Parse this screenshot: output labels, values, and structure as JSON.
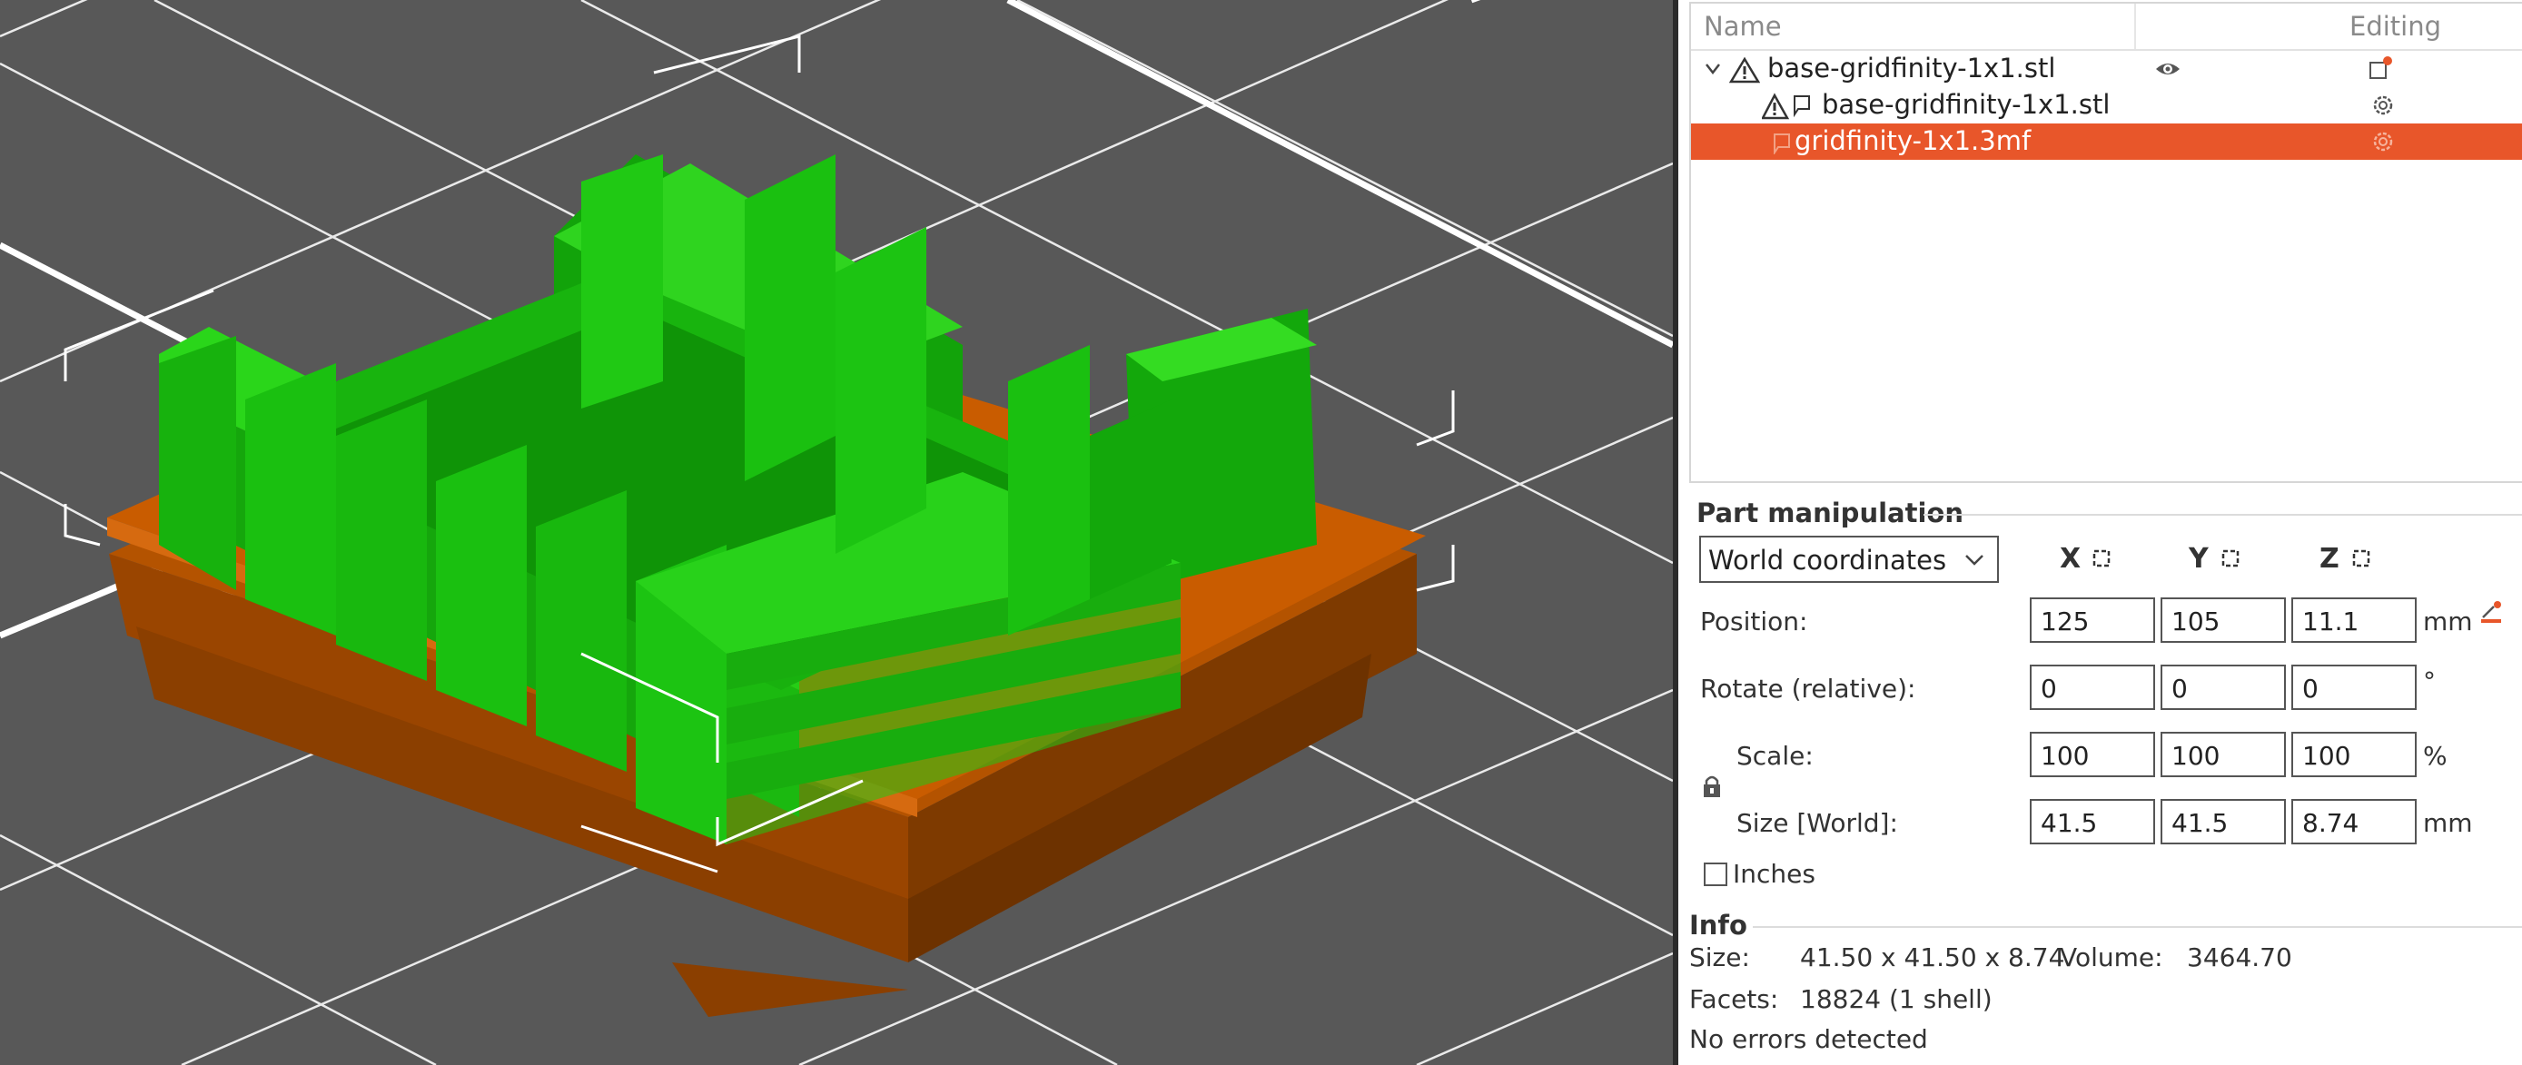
{
  "object_list": {
    "header": {
      "name": "Name",
      "editing": "Editing"
    },
    "rows": [
      {
        "label": "base-gridfinity-1x1.stl",
        "expanded": true,
        "icon": "warning-icon",
        "visible_icon": "eye-icon",
        "edit_icon": "edit-object-icon"
      },
      {
        "label": "base-gridfinity-1x1.stl",
        "icon": "warning-part-icon",
        "edit_icon": "settings-gear-icon"
      },
      {
        "label": "gridfinity-1x1.3mf",
        "selected": true,
        "edit_icon": "settings-gear-icon"
      }
    ]
  },
  "part_manipulation": {
    "title": "Part manipulation",
    "coordinate_system": "World coordinates",
    "axes": [
      "X",
      "Y",
      "Z"
    ],
    "rows": [
      {
        "label": "Position:",
        "values": [
          "125",
          "105",
          "11.1"
        ],
        "unit": "mm"
      },
      {
        "label": "Rotate (relative):",
        "values": [
          "0",
          "0",
          "0"
        ],
        "unit": "°"
      },
      {
        "label": "Scale:",
        "values": [
          "100",
          "100",
          "100"
        ],
        "unit": "%"
      },
      {
        "label": "Size [World]:",
        "values": [
          "41.5",
          "41.5",
          "8.74"
        ],
        "unit": "mm"
      }
    ],
    "inches_label": "Inches",
    "inches_checked": false
  },
  "info": {
    "title": "Info",
    "size_label": "Size:",
    "size_value": "41.50 x 41.50 x 8.74",
    "volume_label": "Volume:",
    "volume_value": "3464.70",
    "facets_label": "Facets:",
    "facets_value": "18824 (1 shell)",
    "status": "No errors detected"
  },
  "colors": {
    "accent": "#e8562a",
    "viewport_bg": "#585858",
    "model_green": "#1fbf12",
    "model_orange": "#c95c00"
  }
}
